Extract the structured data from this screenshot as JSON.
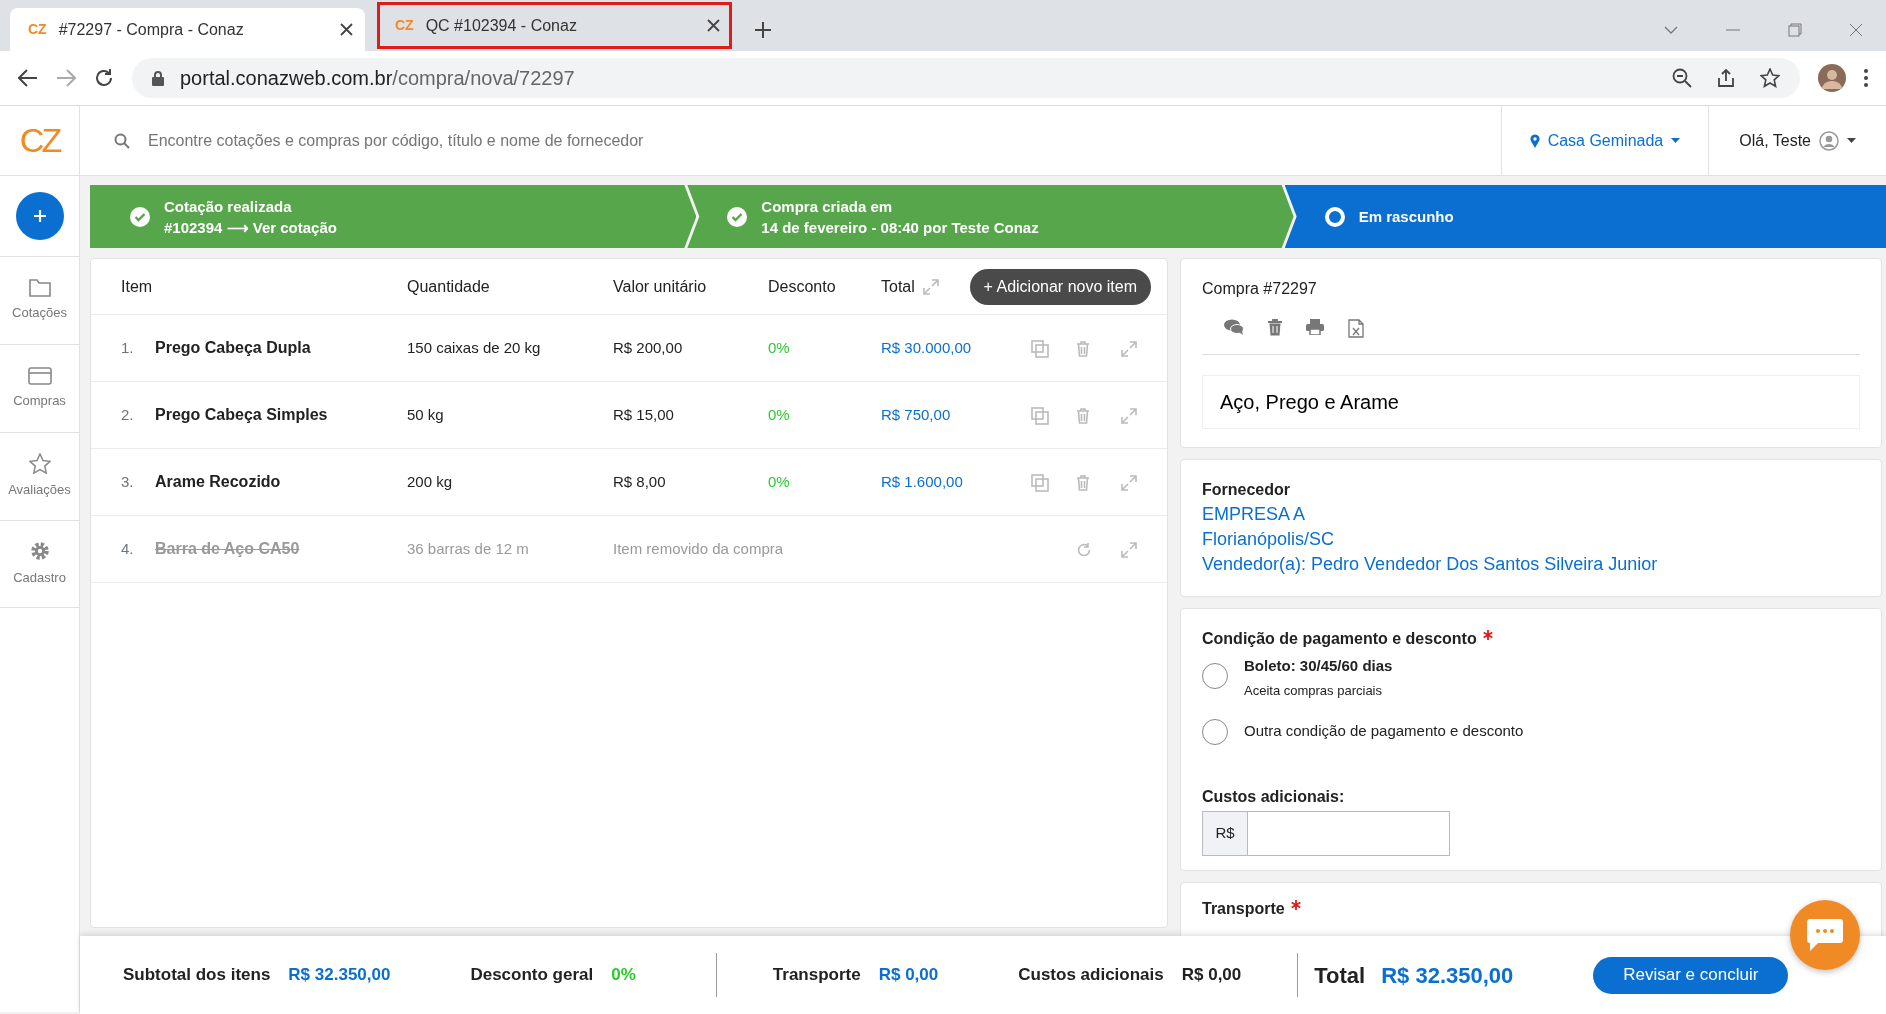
{
  "browser": {
    "tabs": [
      {
        "favicon": "CZ",
        "title": "#72297 - Compra - Conaz",
        "selected": true,
        "highlighted": false
      },
      {
        "favicon": "CZ",
        "title": "QC #102394 - Conaz",
        "selected": false,
        "highlighted": true
      }
    ],
    "url": {
      "host": "portal.conazweb.com.br",
      "path": "/compra/nova/72297"
    }
  },
  "header": {
    "logo": "CZ",
    "search_placeholder": "Encontre cotações e compras por código, título e nome de fornecedor",
    "location": "Casa Geminada",
    "user": "Olá, Teste"
  },
  "sidebar": {
    "items": [
      {
        "label": "Cotações",
        "kind": "folder"
      },
      {
        "label": "Compras",
        "kind": "card"
      },
      {
        "label": "Avaliações",
        "kind": "star"
      },
      {
        "label": "Cadastro",
        "kind": "gear"
      }
    ]
  },
  "steps": [
    {
      "done": true,
      "title": "Cotação realizada",
      "subtitle": "#102394",
      "link": "⟶ Ver cotação"
    },
    {
      "done": true,
      "title": "Compra criada em",
      "subtitle": "14 de fevereiro - 08:40 por Teste Conaz"
    },
    {
      "done": false,
      "title": "Em rascunho"
    }
  ],
  "table": {
    "columns": [
      "Item",
      "Quantidade",
      "Valor unitário",
      "Desconto",
      "Total"
    ],
    "add_button": "+ Adicionar novo item",
    "rows": [
      {
        "index": "1.",
        "name": "Prego Cabeça Dupla",
        "quantity": "150 caixas de 20 kg",
        "unit_price": "R$ 200,00",
        "discount": "0%",
        "total": "R$ 30.000,00",
        "removed": false
      },
      {
        "index": "2.",
        "name": "Prego Cabeça Simples",
        "quantity": "50 kg",
        "unit_price": "R$ 15,00",
        "discount": "0%",
        "total": "R$ 750,00",
        "removed": false
      },
      {
        "index": "3.",
        "name": "Arame Recozido",
        "quantity": "200 kg",
        "unit_price": "R$ 8,00",
        "discount": "0%",
        "total": "R$ 1.600,00",
        "removed": false
      },
      {
        "index": "4.",
        "name": "Barra de Aço CA50",
        "quantity": "36 barras de 12 m",
        "note": "Item removido da compra",
        "removed": true
      }
    ]
  },
  "order": {
    "title": "Compra #72297",
    "name_value": "Aço, Prego e Arame"
  },
  "supplier": {
    "label": "Fornecedor",
    "name": "EMPRESA A",
    "city": "Florianópolis/SC",
    "seller": "Vendedor(a): Pedro Vendedor Dos Santos Silveira Junior"
  },
  "payment": {
    "label": "Condição de pagamento e desconto",
    "required": true,
    "options": [
      {
        "label": "Boleto: 30/45/60 dias",
        "sublabel": "Aceita compras parciais",
        "selected": false
      },
      {
        "label": "Outra condição de pagamento e desconto",
        "selected": false
      }
    ]
  },
  "extra_costs": {
    "label": "Custos adicionais:",
    "prefix": "R$"
  },
  "transport": {
    "label": "Transporte",
    "required": true
  },
  "footer": {
    "summary": [
      {
        "label": "Subtotal dos itens",
        "value": "R$ 32.350,00",
        "kind": "money"
      },
      {
        "label": "Desconto geral",
        "value": "0%",
        "kind": "percent"
      },
      {
        "label": "Transporte",
        "value": "R$ 0,00",
        "kind": "money"
      },
      {
        "label": "Custos adicionais",
        "value": "R$ 0,00",
        "kind": "plain"
      }
    ],
    "total_label": "Total",
    "total_value": "R$ 32.350,00",
    "button": "Revisar e concluir"
  }
}
